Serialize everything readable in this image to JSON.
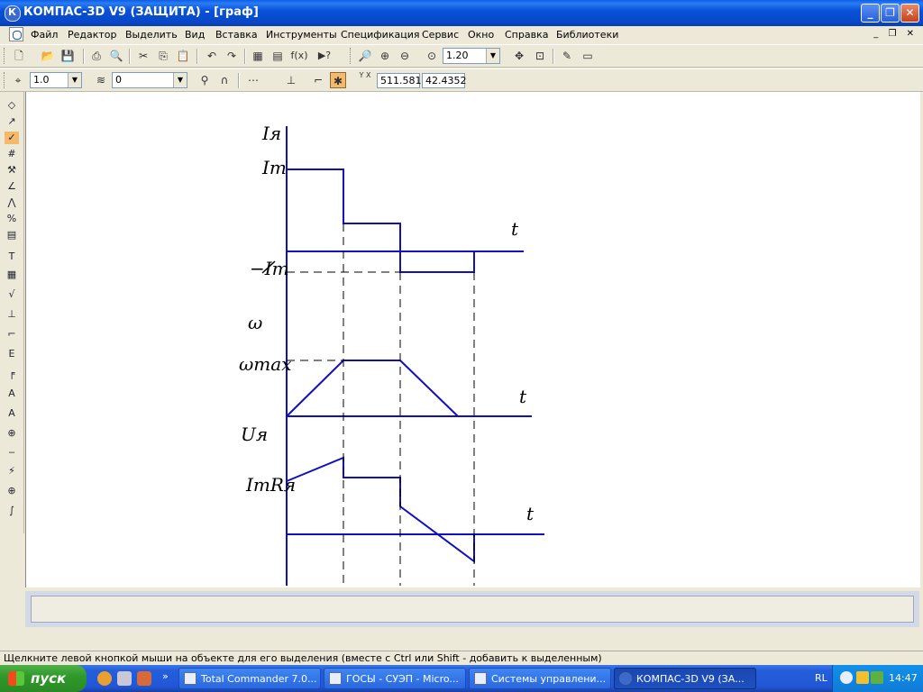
{
  "window": {
    "title": "КОМПАС-3D V9 (ЗАЩИТА) - [граф]",
    "minimize": "_",
    "maximize": "❐",
    "close": "✕"
  },
  "menu": {
    "items": [
      "Файл",
      "Редактор",
      "Выделить",
      "Вид",
      "Вставка",
      "Инструменты",
      "Спецификация",
      "Сервис",
      "Окно",
      "Справка",
      "Библиотеки"
    ],
    "doc_buttons": "_ ❐ ✕"
  },
  "toolbar": {
    "zoom_value": "1.20",
    "fx_label": "f(x)",
    "help_label": "▶?"
  },
  "toolbar2": {
    "step_value": "1.0",
    "layer_value": "0",
    "coord_x": "511.581",
    "coord_y": "42.4352",
    "coord_caption": "Y X"
  },
  "graph": {
    "labels": {
      "Ia": "Iя",
      "Im": "Im",
      "minus_Im": "−Im",
      "t1": "t",
      "omega": "ω",
      "omega_max": "ωmax",
      "t2": "t",
      "Ua": "Uя",
      "ImRa": "ImRя",
      "t3": "t"
    },
    "line_color": "#1010c0",
    "dash_color": "#000000"
  },
  "statusbar": {
    "text": "Щелкните левой кнопкой мыши на объекте для его выделения (вместе с Ctrl или Shift - добавить к выделенным)"
  },
  "taskbar": {
    "start_label": "пуск",
    "tasks": [
      {
        "label": "Total Commander 7.0..."
      },
      {
        "label": "ГОСЫ - СУЭП - Micro..."
      },
      {
        "label": "Системы управлени..."
      },
      {
        "label": "КОМПАС-3D V9 (ЗА..."
      }
    ],
    "lang": "RL",
    "clock": "14:47",
    "more": "»"
  }
}
